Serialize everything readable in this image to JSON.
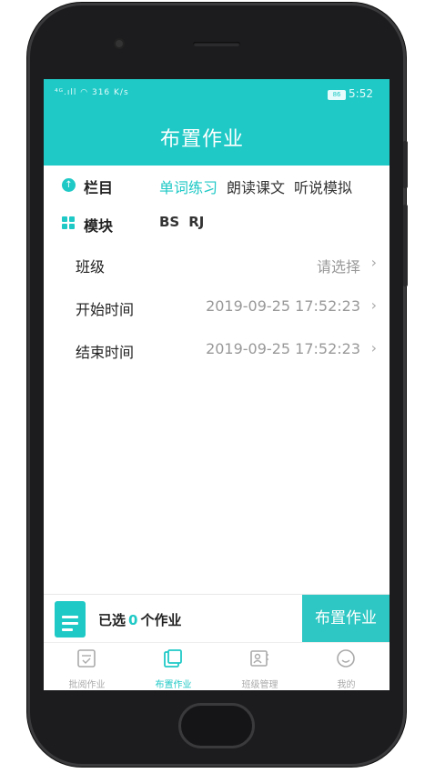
{
  "status_bar": {
    "signal": "⁴ᴳ.ıll",
    "speed": "316 K/s",
    "battery": "86",
    "time": "5:52"
  },
  "header": {
    "title": "布置作业"
  },
  "column_row": {
    "label": "栏目",
    "tabs": [
      {
        "label": "单词练习",
        "active": true
      },
      {
        "label": "朗读课文",
        "active": false
      },
      {
        "label": "听说模拟",
        "active": false
      }
    ]
  },
  "module_row": {
    "label": "模块",
    "values": [
      "BS",
      "RJ"
    ]
  },
  "class_row": {
    "label": "班级",
    "value": "请选择"
  },
  "start_row": {
    "label": "开始时间",
    "value": "2019-09-25 17:52:23"
  },
  "end_row": {
    "label": "结束时间",
    "value": "2019-09-25 17:52:23"
  },
  "bottom_bar": {
    "selected_prefix": "已选",
    "selected_count": "0",
    "selected_suffix": "个作业",
    "assign_button": "布置作业"
  },
  "tabbar": {
    "items": [
      {
        "label": "批阅作业",
        "icon": "review-icon"
      },
      {
        "label": "布置作业",
        "icon": "assign-icon",
        "active": true
      },
      {
        "label": "班级管理",
        "icon": "class-icon"
      },
      {
        "label": "我的",
        "icon": "profile-icon"
      }
    ]
  },
  "colors": {
    "accent": "#1fc9c6",
    "muted": "#999999"
  }
}
